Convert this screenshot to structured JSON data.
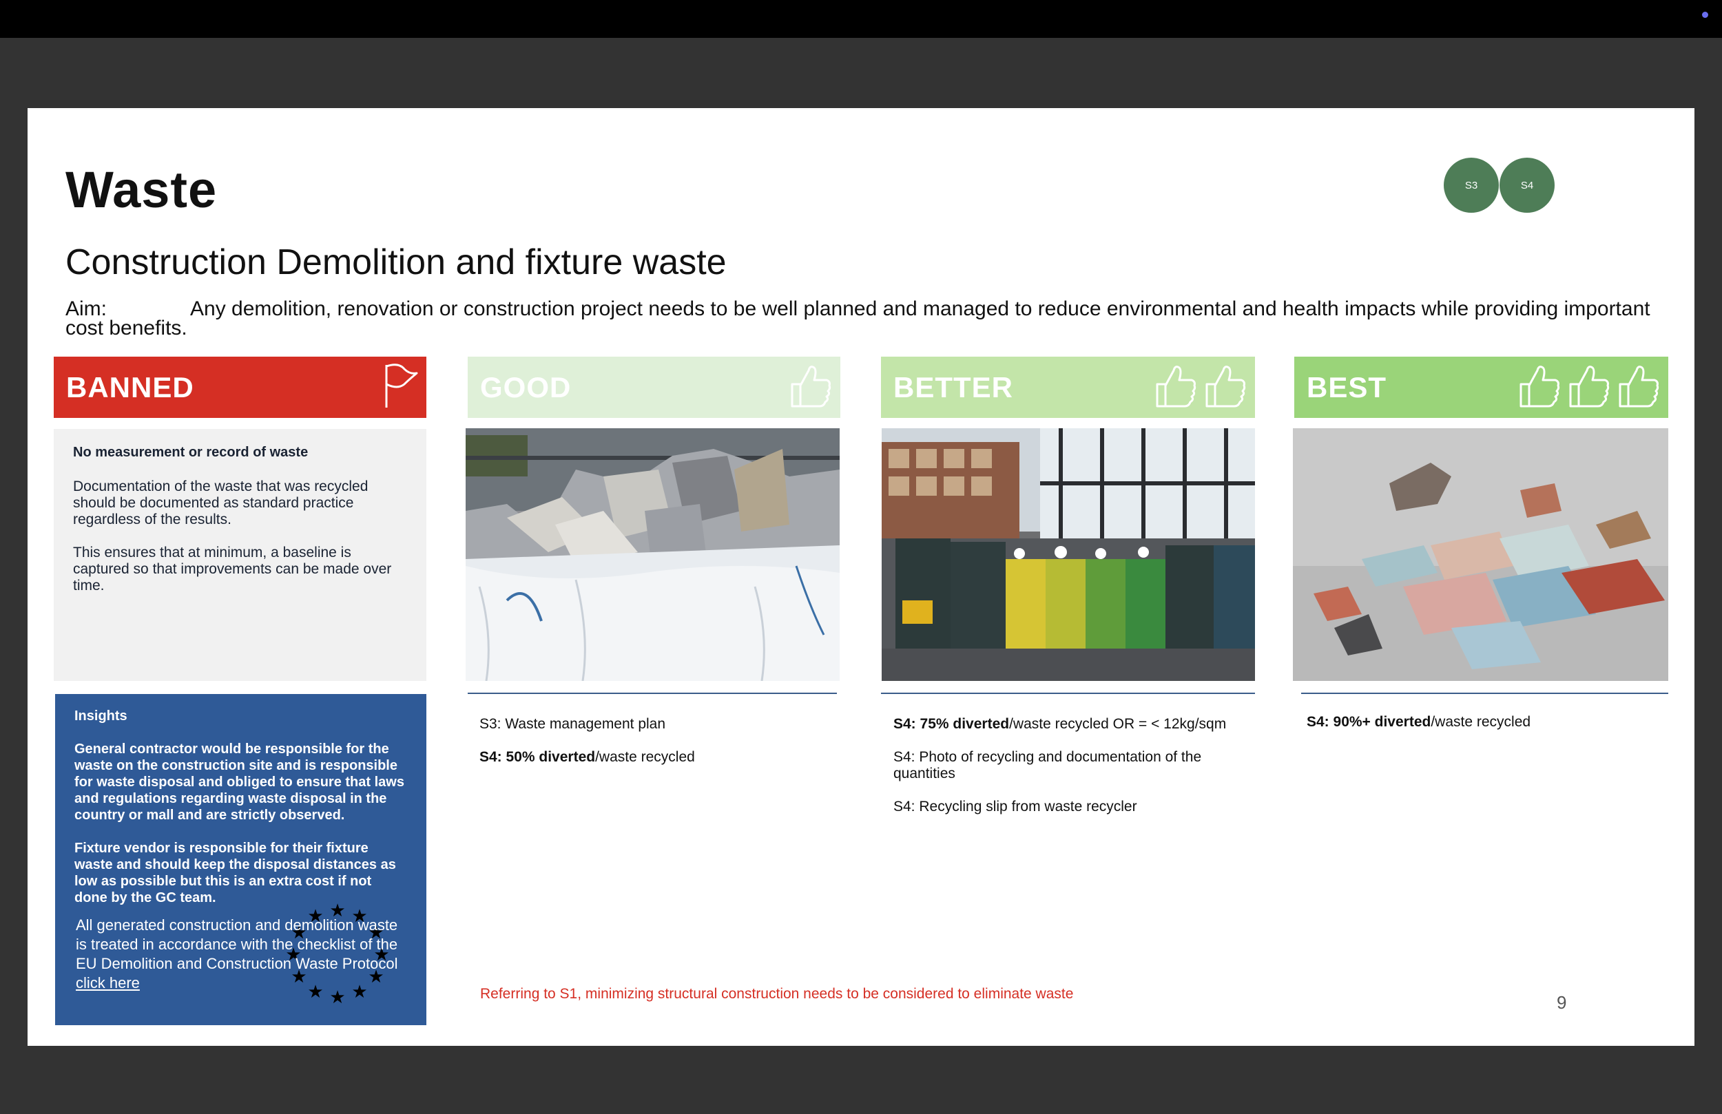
{
  "slide": {
    "title": "Waste",
    "subtitle": "Construction Demolition and fixture waste",
    "aim_label": "Aim:",
    "aim_text": "Any demolition, renovation or construction project needs to be well planned and managed to reduce environmental and health impacts while providing important cost benefits.",
    "badges": [
      "S3",
      "S4"
    ],
    "page_number": "9",
    "footnote": "Referring to S1, minimizing structural construction needs to be considered to eliminate waste"
  },
  "columns": {
    "banned": {
      "label": "BANNED",
      "icon": "flag-icon",
      "color": "#d52f24",
      "heading": "No measurement or record of waste",
      "para1": "Documentation of the waste that was recycled should be documented as standard practice regardless of the results.",
      "para2": "This ensures that at minimum, a baseline is captured so that improvements can be made over time."
    },
    "good": {
      "label": "GOOD",
      "icon": "thumbs-up-icon",
      "icon_count": 1,
      "color": "#dff0d8",
      "line1": "S3: Waste management plan",
      "line2_bold": "S4: 50% diverted",
      "line2_rest": "/waste recycled"
    },
    "better": {
      "label": "BETTER",
      "icon": "thumbs-up-icon",
      "icon_count": 2,
      "color": "#c3e5a9",
      "line1_bold": "S4: 75% diverted",
      "line1_rest": "/waste recycled OR = < 12kg/sqm",
      "line2": "S4: Photo of recycling and documentation of the quantities",
      "line3": "S4: Recycling slip from waste recycler"
    },
    "best": {
      "label": "BEST",
      "icon": "thumbs-up-icon",
      "icon_count": 3,
      "color": "#9ad479",
      "line1_bold": "S4: 90%+ diverted",
      "line1_rest": "/waste recycled"
    }
  },
  "insights": {
    "heading": "Insights",
    "para1": "General contractor would be responsible for the waste on the construction site and is responsible for waste disposal and obliged to ensure that laws and regulations regarding waste disposal in the country or mall and are strictly observed.",
    "para2": "Fixture vendor is responsible for their fixture waste and should keep the disposal distances as low as possible but this is an extra cost if not done by the GC team.",
    "eu_text": "All generated construction and demolition waste is treated in accordance with the checklist of the EU Demolition and Construction Waste Protocol ",
    "link": "click here",
    "bg_color": "#2f5a97"
  }
}
